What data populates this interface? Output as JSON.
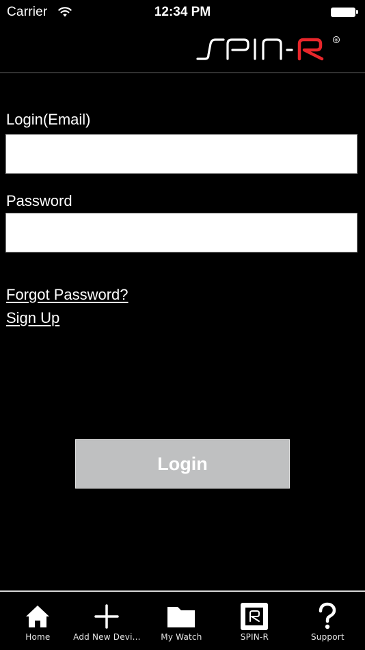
{
  "status_bar": {
    "carrier": "Carrier",
    "time": "12:34 PM",
    "wifi_icon": "wifi-icon",
    "battery_icon": "battery-full-icon"
  },
  "header": {
    "logo_text": "SPIN-R",
    "logo_mark": "®",
    "logo_colors": {
      "primary": "#ffffff",
      "accent": "#e8262b"
    }
  },
  "form": {
    "email_label": "Login(Email)",
    "email_value": "",
    "email_placeholder": "",
    "password_label": "Password",
    "password_value": "",
    "password_placeholder": "",
    "forgot_password_link": "Forgot Password?",
    "sign_up_link": "Sign Up",
    "login_button": "Login",
    "login_button_color": "#bfc0c1"
  },
  "tab_bar": {
    "items": [
      {
        "label": "Home",
        "icon": "home-icon"
      },
      {
        "label": "Add New Devi...",
        "icon": "plus-icon"
      },
      {
        "label": "My Watch",
        "icon": "folder-icon"
      },
      {
        "label": "SPIN-R",
        "icon": "spin-r-logo-icon"
      },
      {
        "label": "Support",
        "icon": "question-mark-icon"
      }
    ]
  }
}
